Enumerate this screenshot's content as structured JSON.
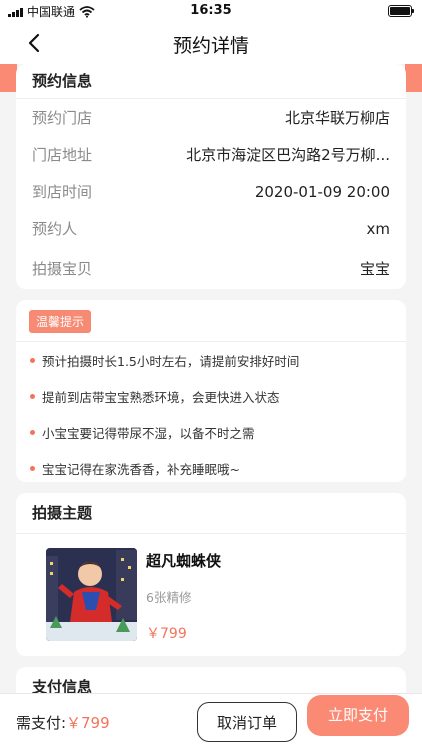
{
  "status_bar": {
    "carrier": "中国联通",
    "time": "16:35"
  },
  "nav": {
    "title": "预约详情"
  },
  "booking": {
    "title": "预约信息",
    "rows": [
      {
        "label": "预约门店",
        "value": "北京华联万柳店"
      },
      {
        "label": "门店地址",
        "value": "北京市海淀区巴沟路2号万柳..."
      },
      {
        "label": "到店时间",
        "value": "2020-01-09 20:00"
      },
      {
        "label": "预约人",
        "value": "xm"
      },
      {
        "label": "拍摄宝贝",
        "value": "宝宝"
      }
    ]
  },
  "tips": {
    "badge": "温馨提示",
    "items": [
      "预计拍摄时长1.5小时左右，请提前安排好时间",
      "提前到店带宝宝熟悉环境，会更快进入状态",
      "小宝宝要记得带尿不湿，以备不时之需",
      "宝宝记得在家洗香香，补充睡眠哦~"
    ]
  },
  "theme": {
    "title": "拍摄主题",
    "name": "超凡蜘蛛侠",
    "desc": "6张精修",
    "price": "￥799"
  },
  "payment": {
    "title": "支付信息"
  },
  "bottom": {
    "pay_label": "需支付:",
    "pay_amount": "￥799",
    "cancel_label": "取消订单",
    "pay_label_btn": "立即支付"
  },
  "colors": {
    "accent": "#fb8a74",
    "price": "#f4735c"
  }
}
